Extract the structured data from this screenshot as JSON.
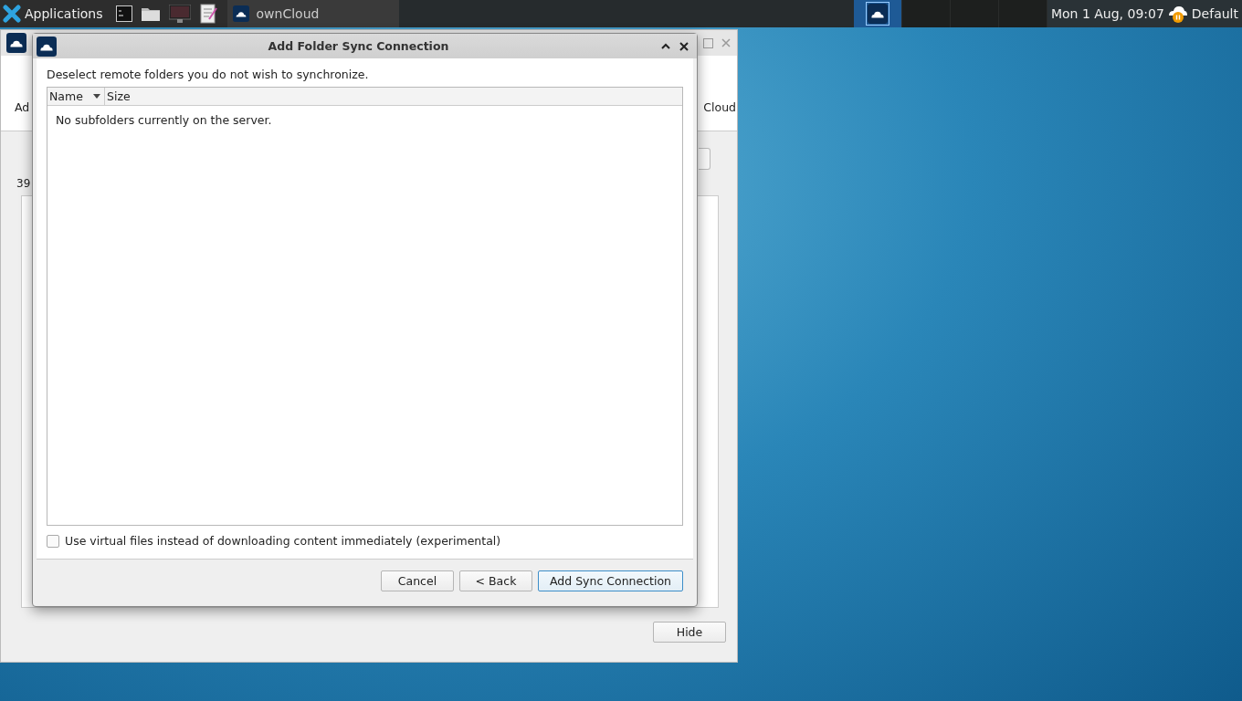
{
  "panel": {
    "menu_label": "Applications",
    "task": {
      "title": "ownCloud"
    },
    "workspaces": [
      {
        "selected": true
      },
      {
        "selected": false
      },
      {
        "selected": false
      },
      {
        "selected": false
      }
    ],
    "clock": "Mon  1 Aug, 09:07",
    "tray_label": "Default"
  },
  "back_window": {
    "header_left": "Ad",
    "header_right": "Cloud",
    "info": "39",
    "hide_button": "Hide"
  },
  "dialog": {
    "title": "Add Folder Sync Connection",
    "instruction": "Deselect remote folders you do not wish to synchronize.",
    "columns": [
      {
        "label": "Name",
        "sorted": true
      },
      {
        "label": "Size",
        "sorted": false
      }
    ],
    "empty_message": "No subfolders currently on the server.",
    "virtual_files": {
      "label": "Use virtual files instead of downloading content immediately (experimental)",
      "checked": false
    },
    "buttons": [
      {
        "label": "Cancel",
        "default": false
      },
      {
        "label": "< Back",
        "default": false
      },
      {
        "label": "Add Sync Connection",
        "default": true
      }
    ]
  }
}
